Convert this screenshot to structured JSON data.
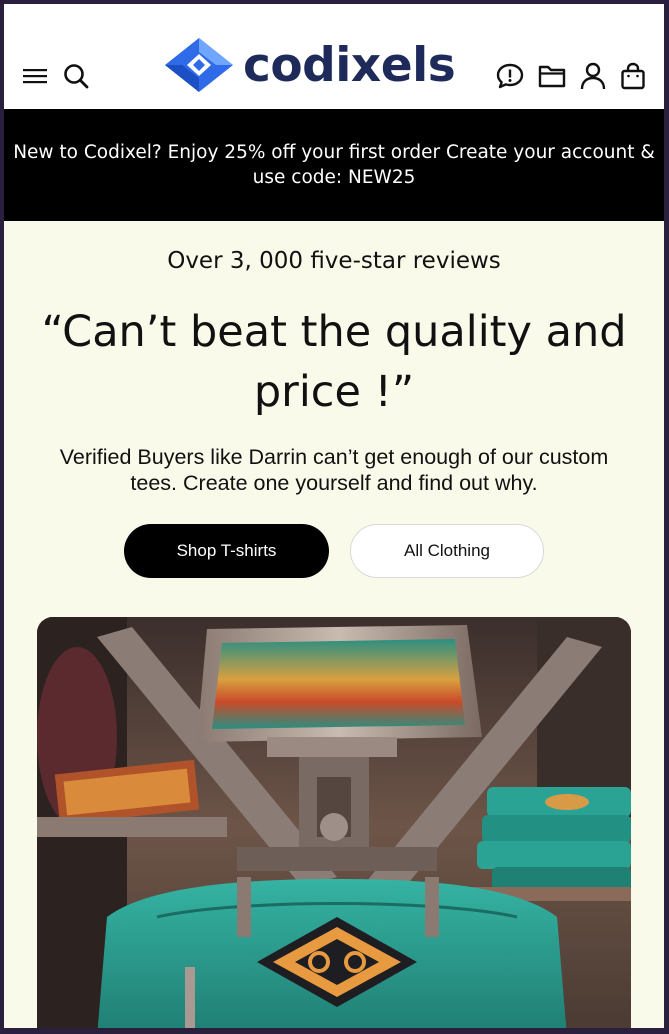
{
  "brand": {
    "name": "codixels",
    "logo_color": "#1e2a5a",
    "logo_accent": "#2f6be8"
  },
  "header": {
    "icons": [
      "menu-icon",
      "search-icon",
      "chat-icon",
      "folder-icon",
      "account-icon",
      "bag-icon"
    ]
  },
  "promo": {
    "text": "New to Codixel? Enjoy 25% off your first order Create your account & use code: NEW25"
  },
  "hero_section": {
    "reviews_line": "Over 3, 000 five-star reviews",
    "quote": "“Can’t beat the quality and price !”",
    "subtext": "Verified Buyers like Darrin can’t get enough of our custom tees. Create one yourself and find out why.",
    "primary_button": "Shop T-shirts",
    "secondary_button": "All Clothing"
  },
  "colors": {
    "page_bg": "#fafaeb",
    "promo_bg": "#000000",
    "shirt_teal": "#2aa394"
  }
}
